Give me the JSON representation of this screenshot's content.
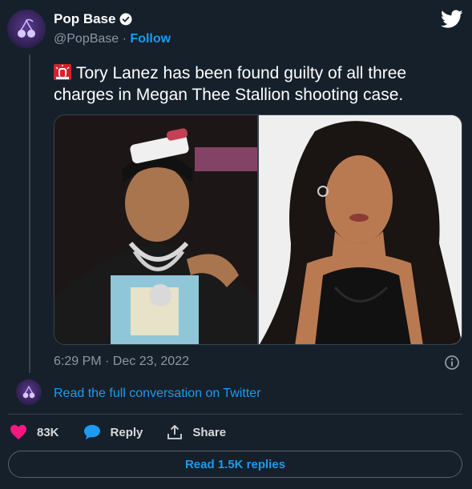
{
  "author": {
    "name": "Pop Base",
    "handle": "@PopBase",
    "separator": "·",
    "follow_label": "Follow"
  },
  "icons": {
    "avatar": "pop-base-cherry-logo",
    "verified": "verified-badge-icon",
    "brand": "twitter-bird-icon",
    "emoji": "police-light-emoji",
    "info": "info-icon",
    "like": "heart-icon",
    "reply": "speech-bubble-icon",
    "share": "share-upload-icon"
  },
  "tweet": {
    "text": "Tory Lanez has been found guilty of all three charges in Megan Thee Stallion shooting case.",
    "timestamp": "6:29 PM · Dec 23, 2022"
  },
  "media": [
    {
      "alt": "photo-tory-lanez"
    },
    {
      "alt": "photo-megan-thee-stallion"
    }
  ],
  "conversation_link": "Read the full conversation on Twitter",
  "actions": {
    "like_count": "83K",
    "reply_label": "Reply",
    "share_label": "Share"
  },
  "read_replies_label": "Read 1.5K replies",
  "colors": {
    "background": "#15202b",
    "accent": "#1d9bf0",
    "like": "#f91880",
    "muted": "#8b98a5"
  }
}
